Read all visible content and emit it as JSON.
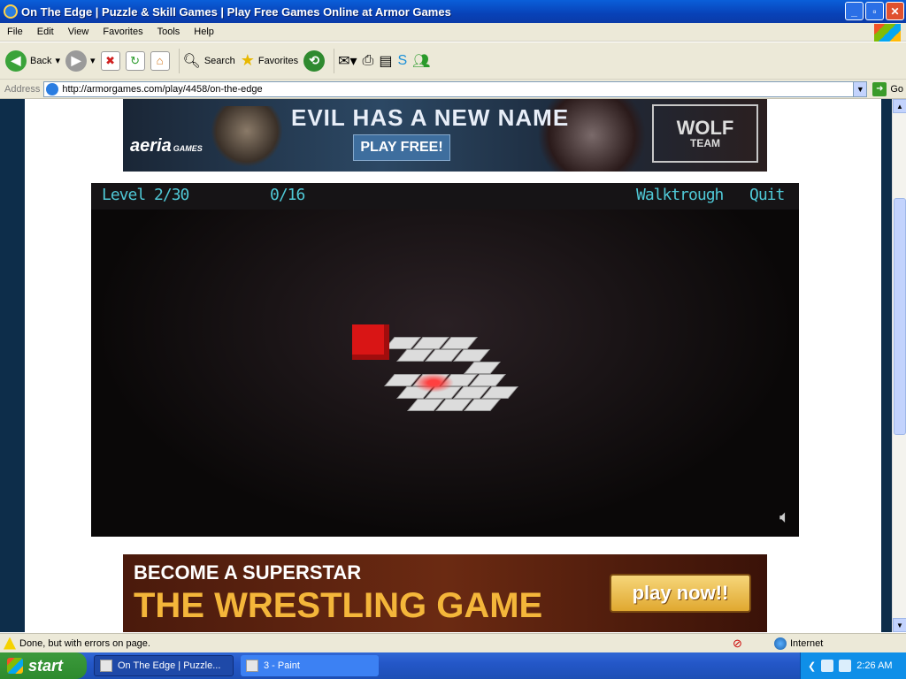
{
  "window": {
    "title": "On The Edge | Puzzle & Skill Games | Play Free Games Online at Armor Games"
  },
  "menu": [
    "File",
    "Edit",
    "View",
    "Favorites",
    "Tools",
    "Help"
  ],
  "toolbar": {
    "back": "Back",
    "search": "Search",
    "favorites": "Favorites"
  },
  "address": {
    "label": "Address",
    "url": "http://armorgames.com/play/4458/on-the-edge",
    "go": "Go"
  },
  "ads": {
    "top": {
      "brand": "aeria",
      "brand_sub": "GAMES",
      "headline": "EVIL HAS A NEW NAME",
      "cta": "PLAY FREE!",
      "logo_top": "WOLF",
      "logo_bottom": "TEAM"
    },
    "bottom": {
      "line1": "BECOME A SUPERSTAR",
      "line2": "THE WRESTLING GAME",
      "cta": "play now!!"
    }
  },
  "game": {
    "level": "Level 2/30",
    "moves": "0/16",
    "walkthrough": "Walktrough",
    "quit": "Quit"
  },
  "status": {
    "text": "Done, but with errors on page.",
    "zone": "Internet"
  },
  "taskbar": {
    "start": "start",
    "tasks": [
      "On The Edge | Puzzle...",
      "3 - Paint"
    ],
    "clock": "2:26 AM"
  }
}
